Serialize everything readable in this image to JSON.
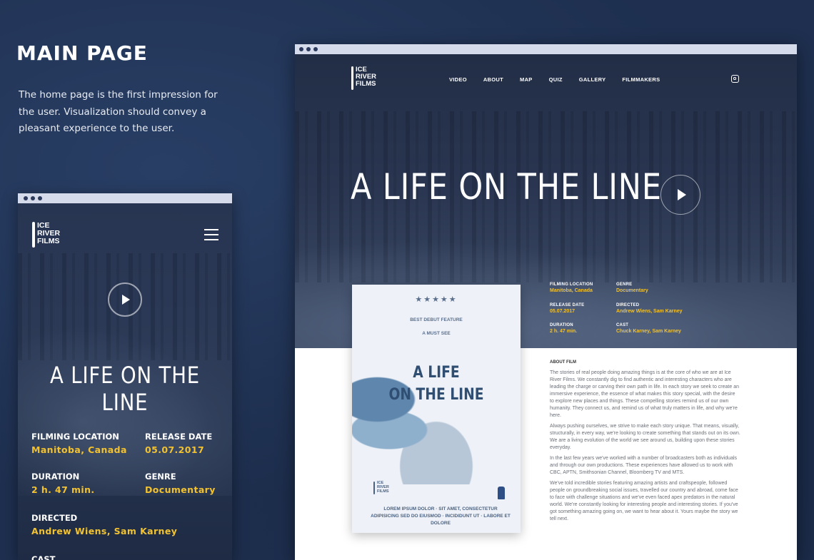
{
  "presentation": {
    "title": "MAIN PAGE",
    "description": "The home page is the first impression for the user. Visualization should convey a pleasant experience to the user."
  },
  "brand": {
    "logo_lines": [
      "ICE",
      "RIVER",
      "FILMS"
    ]
  },
  "film": {
    "title": "A LIFE ON THE LINE",
    "info": {
      "filming_location": {
        "label": "FILMING LOCATION",
        "value": "Manitoba, Canada"
      },
      "release_date": {
        "label": "RELEASE DATE",
        "value": "05.07.2017"
      },
      "duration": {
        "label": "DURATION",
        "value": "2 h. 47 min."
      },
      "genre": {
        "label": "GENRE",
        "value": "Documentary"
      },
      "directed": {
        "label": "DIRECTED",
        "value": "Andrew Wiens, Sam Karney"
      },
      "cast": {
        "label": "CAST",
        "value": "Chuck Karney, Sam Karney"
      }
    }
  },
  "nav": {
    "items": [
      "VIDEO",
      "ABOUT",
      "MAP",
      "QUIZ",
      "GALLERY",
      "FILMMAKERS"
    ]
  },
  "poster": {
    "stars": "★★★★★",
    "award_1": "BEST DEBUT FEATURE",
    "award_2": "A MUST SEE",
    "title_line_1": "A LIFE",
    "title_line_2": "ON THE LINE",
    "credits": "LOREM IPSUM DOLOR · SIT AMET, CONSECTETUR ADIPISICING SED DO EIUSMOD · INCIDIDUNT UT · LABORE ET DOLORE"
  },
  "about": {
    "label": "ABOUT FILM",
    "paragraphs": [
      "The stories of real people doing amazing things is at the core of who we are at Ice River Films. We constantly dig to find authentic and interesting characters who are leading the charge or carving their own path in life. In each story we seek to create an immersive experience, the essence of what makes this story special, with the desire to explore new places and things. These compelling stories remind us of our own humanity. They connect us, and remind us of what truly matters in life, and why we're here.",
      "Always pushing ourselves, we strive to make each story unique. That means, visually, structurally, in every way, we're looking to create something that stands out on its own. We are a living evolution of the world we see around us, building upon these stories everyday.",
      "In the last few years we've worked with a number of broadcasters both as individuals and through our own productions. These experiences have allowed us to work with CBC, APTN, Smithsonian Channel, Bloomberg TV and MTS.",
      "We've told incredible stories featuring amazing artists and craftspeople, followed people on groundbreaking social issues, travelled our country and abroad, come face to face with challenge situations and we've even faced apex predators in the natural world. We're constantly looking for interesting people and interesting stories. If you've got something amazing going on, we want to hear about it. Yours maybe the story we tell next."
    ]
  }
}
